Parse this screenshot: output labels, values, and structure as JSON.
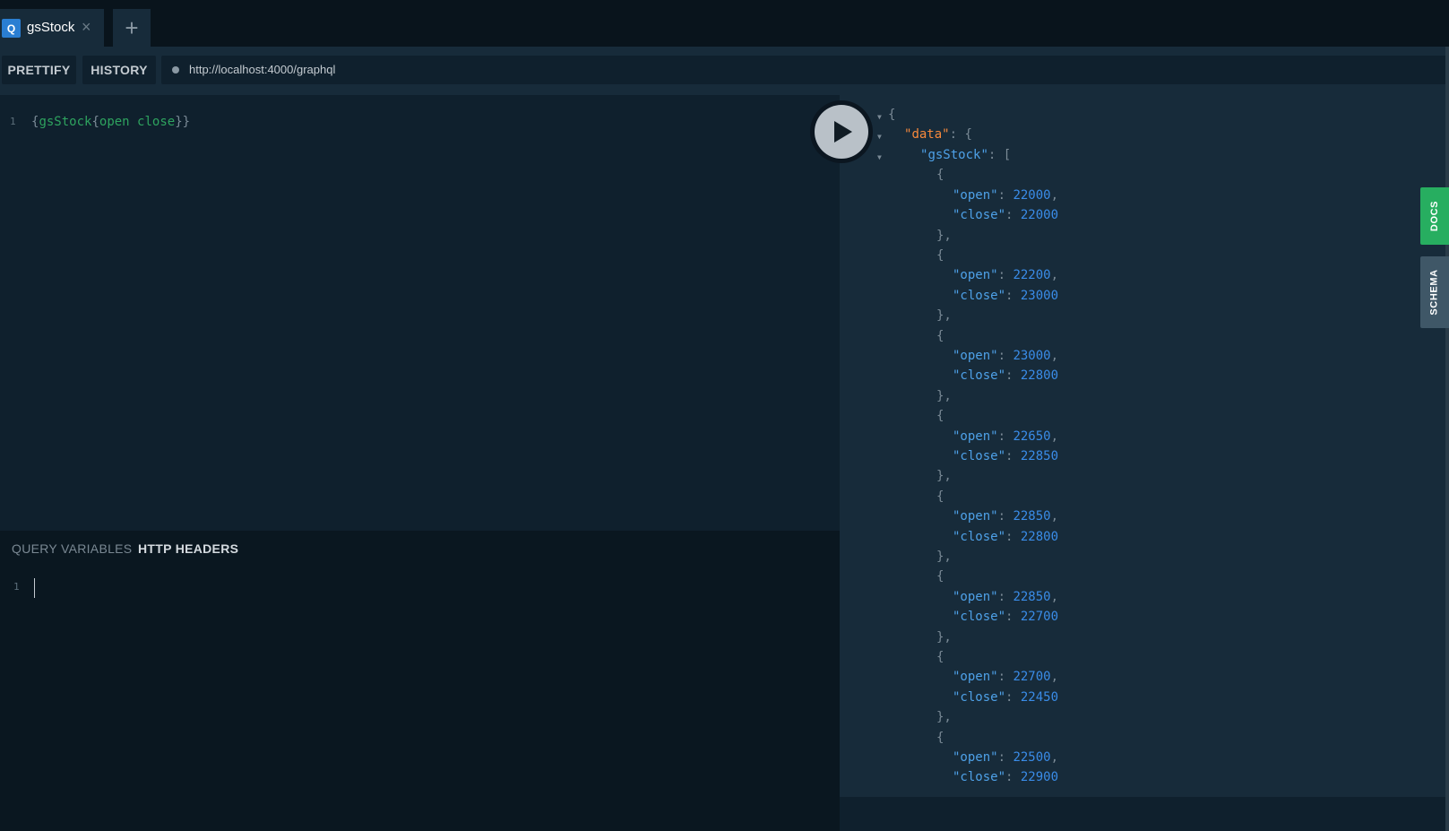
{
  "tab": {
    "badge": "Q",
    "title": "gsStock",
    "close": "×",
    "new": "+"
  },
  "toolbar": {
    "prettify": "PRETTIFY",
    "history": "HISTORY",
    "url": "http://localhost:4000/graphql"
  },
  "editor": {
    "line_number": "1",
    "query_open": "{",
    "query_field": "gsStock",
    "query_inner_open": "{",
    "query_args": "open close",
    "query_close": "}}"
  },
  "vars_panel": {
    "query_variables": "QUERY VARIABLES",
    "http_headers": "HTTP HEADERS",
    "line_number": "1"
  },
  "side_tabs": {
    "docs": "DOCS",
    "schema": "SCHEMA"
  },
  "colors": {
    "docs": "#27ae60",
    "schema": "#3f5767",
    "run": "#b9c1c8",
    "accent": "#2a7ed2"
  },
  "result": {
    "root_key": "data",
    "list_key": "gsStock",
    "items": [
      {
        "open": 22000,
        "close": 22000
      },
      {
        "open": 22200,
        "close": 23000
      },
      {
        "open": 23000,
        "close": 22800
      },
      {
        "open": 22650,
        "close": 22850
      },
      {
        "open": 22850,
        "close": 22800
      },
      {
        "open": 22850,
        "close": 22700
      },
      {
        "open": 22700,
        "close": 22450
      },
      {
        "open": 22500,
        "close": 22900
      }
    ]
  }
}
